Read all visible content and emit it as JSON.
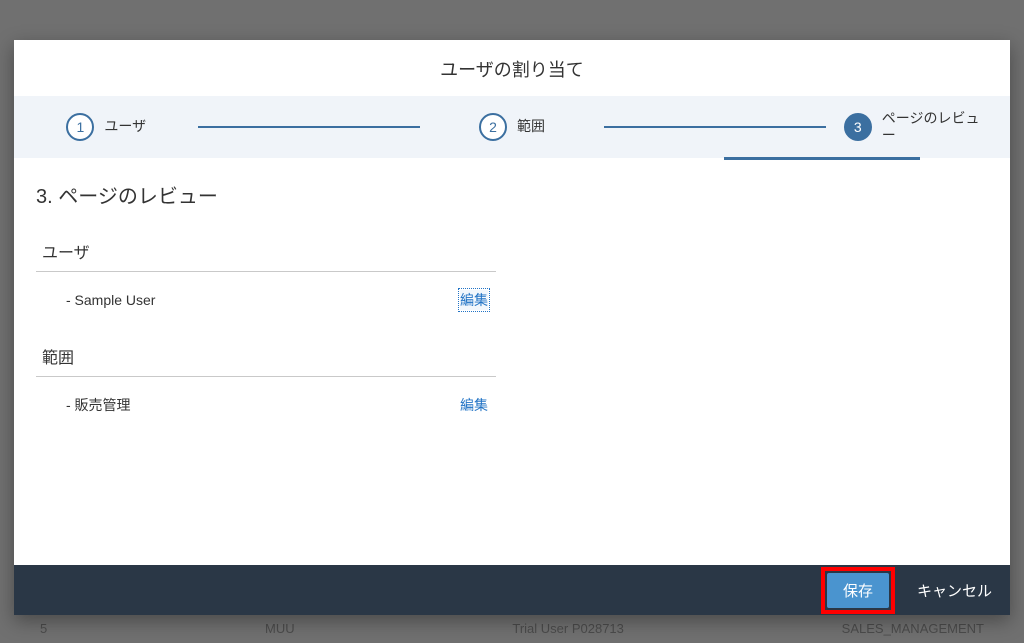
{
  "dialog": {
    "title": "ユーザの割り当て",
    "steps": [
      {
        "num": "1",
        "label": "ユーザ"
      },
      {
        "num": "2",
        "label": "範囲"
      },
      {
        "num": "3",
        "label": "ページのレビュー"
      }
    ],
    "content": {
      "heading": "3. ページのレビュー",
      "blocks": [
        {
          "title": "ユーザ",
          "value": "- Sample User",
          "edit": "編集"
        },
        {
          "title": "範囲",
          "value": "- 販売管理",
          "edit": "編集"
        }
      ]
    },
    "footer": {
      "save": "保存",
      "cancel": "キャンセル"
    }
  },
  "background": {
    "col_a": "5",
    "col_b": "MUU",
    "col_c": "Trial User P028713",
    "col_d": "SALES_MANAGEMENT"
  }
}
